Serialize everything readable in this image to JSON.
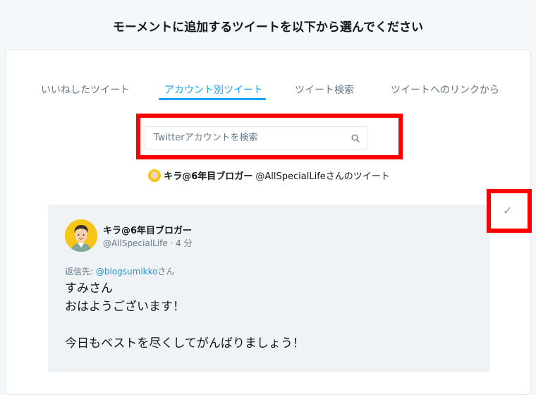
{
  "header": {
    "title": "モーメントに追加するツイートを以下から選んでください"
  },
  "tabs": [
    {
      "label": "いいねしたツイート"
    },
    {
      "label": "アカウント別ツイート"
    },
    {
      "label": "ツイート検索"
    },
    {
      "label": "ツイートへのリンクから"
    }
  ],
  "active_tab": "アカウント別ツイート",
  "search": {
    "placeholder": "Twitterアカウントを検索",
    "value": ""
  },
  "user_line": {
    "name": "キラ@6年目ブロガー",
    "suffix": " @AllSpecialLifeさんのツイート"
  },
  "tweet": {
    "author_name": "キラ@6年目ブロガー",
    "handle_time": "@AllSpecialLife · 4 分",
    "reply_prefix": "返信先: ",
    "reply_mention": "@blogsumikko",
    "reply_suffix": "さん",
    "lines": [
      "すみさん",
      "おはようございます！",
      "",
      "今日もベストを尽くしてがんばりましょう！"
    ]
  },
  "select_icon": "check-icon",
  "colors": {
    "accent": "#1da1f2",
    "highlight_box": "#ff0000",
    "card_bg": "#f0f3f6",
    "avatar_bg": "#f5c518"
  }
}
